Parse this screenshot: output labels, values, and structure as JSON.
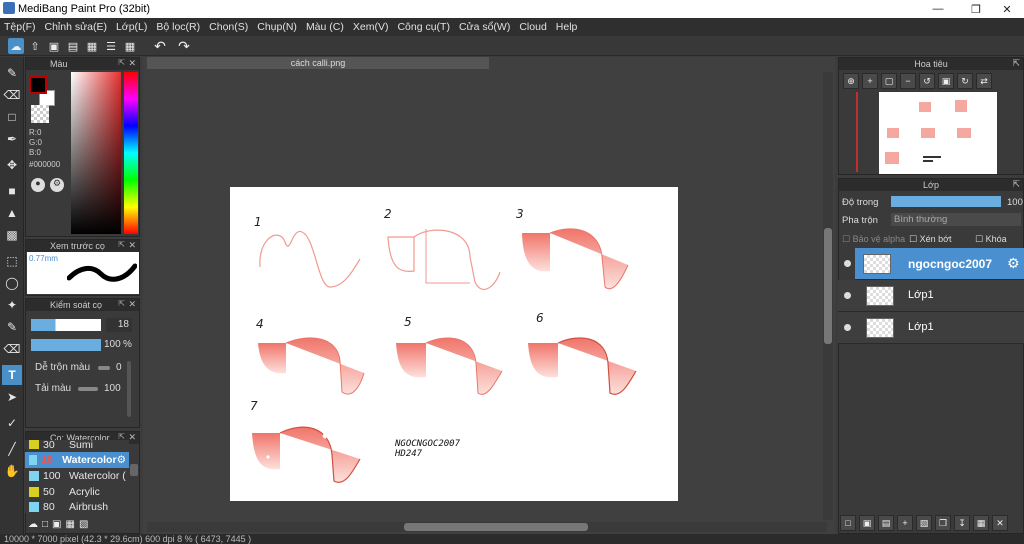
{
  "window": {
    "title": "MediBang Paint Pro (32bit)"
  },
  "menu": [
    "Tệp(F)",
    "Chỉnh sửa(E)",
    "Lớp(L)",
    "Bộ lọc(R)",
    "Chọn(S)",
    "Chụp(N)",
    "Màu (C)",
    "Xem(V)",
    "Công cụ(T)",
    "Cửa sổ(W)",
    "Cloud",
    "Help"
  ],
  "color_panel": {
    "title": "Màu",
    "r": "R:0",
    "g": "G:0",
    "b": "B:0",
    "hex": "#000000",
    "fg": "#000000",
    "bg": "#ffffff",
    "accent": "#c00000"
  },
  "preview_panel": {
    "title": "Xem trước cọ",
    "size": "0.77mm"
  },
  "brush_control": {
    "title": "Kiểm soát cọ",
    "size": "18",
    "opacity": "100",
    "opacity_unit": "%",
    "blend_label": "Dễ trộn màu",
    "blend_value": "0",
    "load_label": "Tải màu",
    "load_value": "100"
  },
  "brush_list": {
    "title": "Cọ: Watercolor",
    "items": [
      {
        "size": "30",
        "name": "Sumi",
        "color": "#d8d020"
      },
      {
        "size": "18",
        "name": "Watercolor",
        "color": "#7fd4f0",
        "selected": true
      },
      {
        "size": "100",
        "name": "Watercolor (",
        "color": "#7fd4f0"
      },
      {
        "size": "50",
        "name": "Acrylic",
        "color": "#d8d020"
      },
      {
        "size": "80",
        "name": "Airbrush",
        "color": "#7fd4f0"
      }
    ]
  },
  "document": {
    "tab": "cách calli.png",
    "numbers": [
      "1",
      "2",
      "3",
      "4",
      "5",
      "6",
      "7"
    ],
    "signature1": "NGOCNGOC2007",
    "signature2": "HD247"
  },
  "navigator": {
    "title": "Hoa tiêu"
  },
  "layer_panel": {
    "title": "Lớp",
    "opacity_label": "Độ trong",
    "opacity_value": "100",
    "blend_label": "Pha trộn",
    "blend_value": "Bình thường",
    "protect_alpha": "Bảo vệ alpha",
    "clipping": "Xén bớt",
    "lock": "Khóa",
    "layers": [
      {
        "name": "ngocngoc2007",
        "selected": true
      },
      {
        "name": "Lớp1",
        "selected": false
      },
      {
        "name": "Lớp1",
        "selected": false
      }
    ]
  },
  "status": "10000 * 7000 pixel   (42.3 * 29.6cm)   600 dpi   8 %   ( 6473, 7445 )"
}
